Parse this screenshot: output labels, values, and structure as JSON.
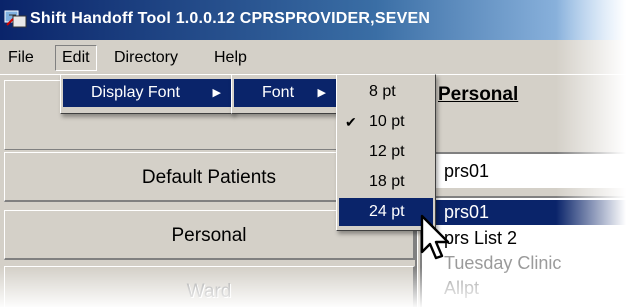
{
  "window": {
    "title": "Shift Handoff Tool 1.0.0.12  CPRSPROVIDER,SEVEN",
    "icon": "app-icon"
  },
  "menubar": {
    "items": [
      {
        "label": "File"
      },
      {
        "label": "Edit"
      },
      {
        "label": "Directory"
      },
      {
        "label": "Help"
      }
    ]
  },
  "edit_menu": {
    "items": [
      {
        "label": "Display Font",
        "submenu": true
      }
    ]
  },
  "display_font_menu": {
    "items": [
      {
        "label": "Font",
        "submenu": true
      }
    ]
  },
  "font_size_menu": {
    "items": [
      {
        "label": "8 pt",
        "checked": false
      },
      {
        "label": "10 pt",
        "checked": true
      },
      {
        "label": "12 pt",
        "checked": false
      },
      {
        "label": "18 pt",
        "checked": false
      },
      {
        "label": "24 pt",
        "checked": false,
        "highlighted": true
      }
    ],
    "check_glyph": "✔"
  },
  "buttons": [
    {
      "label": "Default Patients",
      "enabled": true
    },
    {
      "label": "Personal",
      "enabled": true
    },
    {
      "label": "Ward",
      "enabled": false
    }
  ],
  "right_panel": {
    "heading": "Personal",
    "textbox_value": "prs01",
    "list_items": [
      {
        "label": "prs01",
        "selected": true
      },
      {
        "label": "prs List 2",
        "selected": false
      },
      {
        "label": "Tuesday Clinic",
        "selected": false
      },
      {
        "label": "Allpt",
        "selected": false
      }
    ]
  },
  "colors": {
    "highlight": "#0a246a",
    "face": "#d4d0c8",
    "title_gradient_start": "#0a246a",
    "title_gradient_end": "#a6caf0"
  }
}
